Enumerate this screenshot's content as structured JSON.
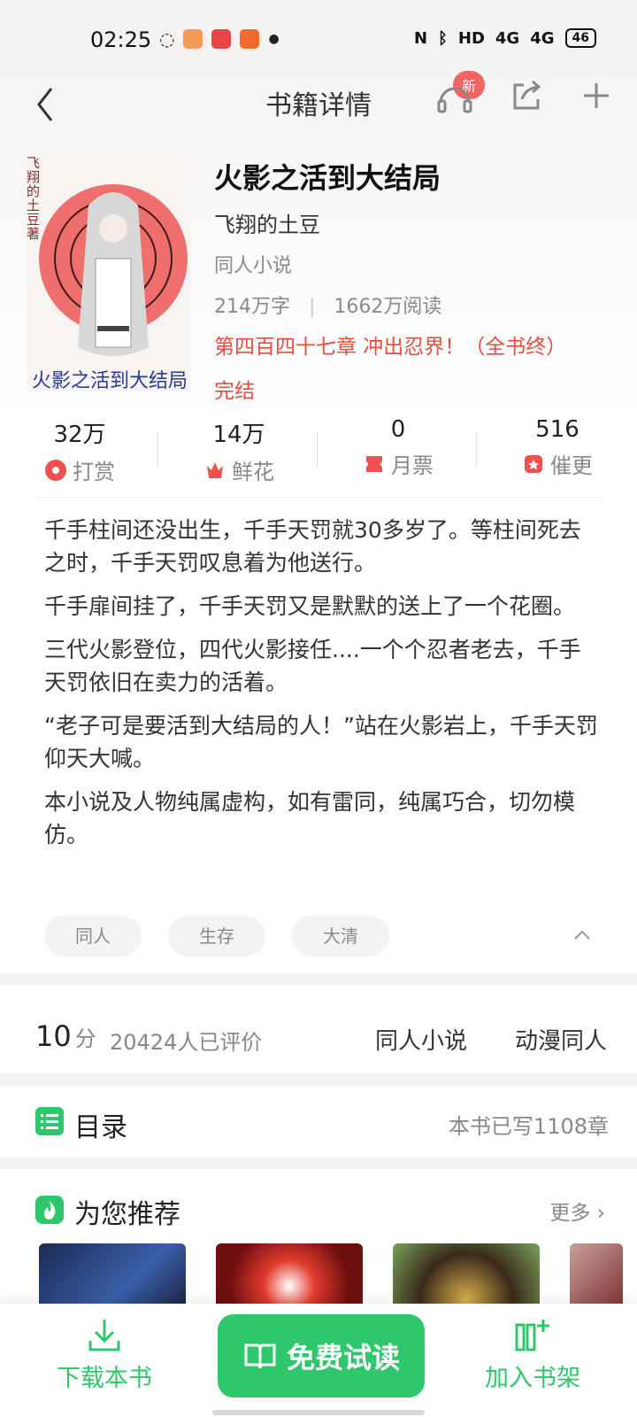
{
  "status_bar": {
    "time": "02:25",
    "network": "HD",
    "signal1": "4G",
    "signal2": "4G",
    "battery": "46"
  },
  "nav": {
    "title": "书籍详情",
    "badge": "新"
  },
  "book": {
    "title": "火影之活到大结局",
    "author": "飞翔的土豆",
    "category": "同人小说",
    "word_count": "214万字",
    "reads": "1662万阅读",
    "latest_chapter": "第四百四十七章 冲出忍界！（全书终）",
    "status": "完结",
    "cover_author_text": "飞翔的土豆著",
    "cover_title_text": "火影之活到大结局"
  },
  "metrics": [
    {
      "value": "32万",
      "label": "打赏",
      "icon": "reward-icon"
    },
    {
      "value": "14万",
      "label": "鲜花",
      "icon": "flower-icon"
    },
    {
      "value": "0",
      "label": "月票",
      "icon": "ticket-icon"
    },
    {
      "value": "516",
      "label": "催更",
      "icon": "urge-icon"
    }
  ],
  "description": [
    "千手柱间还没出生，千手天罚就30多岁了。等柱间死去之时，千手天罚叹息着为他送行。",
    "千手扉间挂了，千手天罚又是默默的送上了一个花圈。",
    "三代火影登位，四代火影接任....一个个忍者老去，千手天罚依旧在卖力的活着。",
    "“老子可是要活到大结局的人！”站在火影岩上，千手天罚仰天大喊。",
    "本小说及人物纯属虚构，如有雷同，纯属巧合，切勿模仿。"
  ],
  "tags": [
    "同人",
    "生存",
    "大清"
  ],
  "rating": {
    "score": "10",
    "unit": "分",
    "raters": "20424人已评价",
    "tag1": "同人小说",
    "tag2": "动漫同人"
  },
  "toc": {
    "label": "目录",
    "count": "本书已写1108章"
  },
  "recommend": {
    "label": "为您推荐",
    "more": "更多"
  },
  "bottom": {
    "download": "下载本书",
    "read": "免费试读",
    "shelf": "加入书架"
  },
  "colors": {
    "accent": "#2ec76b",
    "red": "#e74c3c"
  }
}
